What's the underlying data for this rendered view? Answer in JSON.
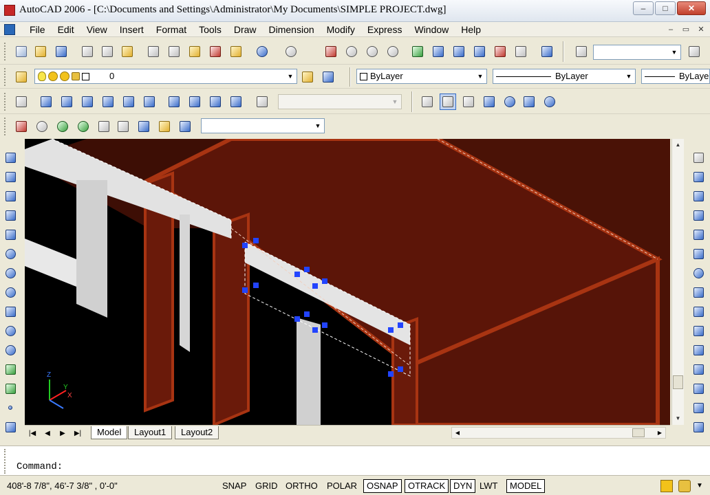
{
  "window": {
    "title": "AutoCAD 2006 - [C:\\Documents and Settings\\Administrator\\My Documents\\SIMPLE PROJECT.dwg]",
    "controls": {
      "minimize": "–",
      "maximize": "□",
      "close": "✕"
    }
  },
  "menu": {
    "items": [
      "File",
      "Edit",
      "View",
      "Insert",
      "Format",
      "Tools",
      "Draw",
      "Dimension",
      "Modify",
      "Express",
      "Window",
      "Help"
    ],
    "mdi": {
      "minimize": "–",
      "restore": "▭",
      "close": "✕"
    }
  },
  "layers": {
    "current": "0"
  },
  "properties": {
    "color": "ByLayer",
    "linetype": "ByLayer",
    "lineweight": "ByLayer"
  },
  "tabs": [
    "Model",
    "Layout1",
    "Layout2"
  ],
  "active_tab": "Model",
  "command": {
    "prompt": "Command:"
  },
  "status": {
    "coordinates": "408'-8 7/8\",  46'-7 3/8\" , 0'-0\"",
    "toggles": [
      {
        "label": "SNAP",
        "on": false
      },
      {
        "label": "GRID",
        "on": false
      },
      {
        "label": "ORTHO",
        "on": false
      },
      {
        "label": "POLAR",
        "on": false
      },
      {
        "label": "OSNAP",
        "on": true
      },
      {
        "label": "OTRACK",
        "on": true
      },
      {
        "label": "DYN",
        "on": true
      },
      {
        "label": "LWT",
        "on": false
      },
      {
        "label": "MODEL",
        "on": true
      }
    ]
  },
  "ucs": {
    "x_label": "X",
    "y_label": "Y",
    "z_label": "Z"
  },
  "colors": {
    "viewport_bg": "#000000",
    "wall_fill": "#5a1408",
    "wall_edge": "#a83412",
    "grip": "#2244ff",
    "beam": "#d8d8d8"
  }
}
